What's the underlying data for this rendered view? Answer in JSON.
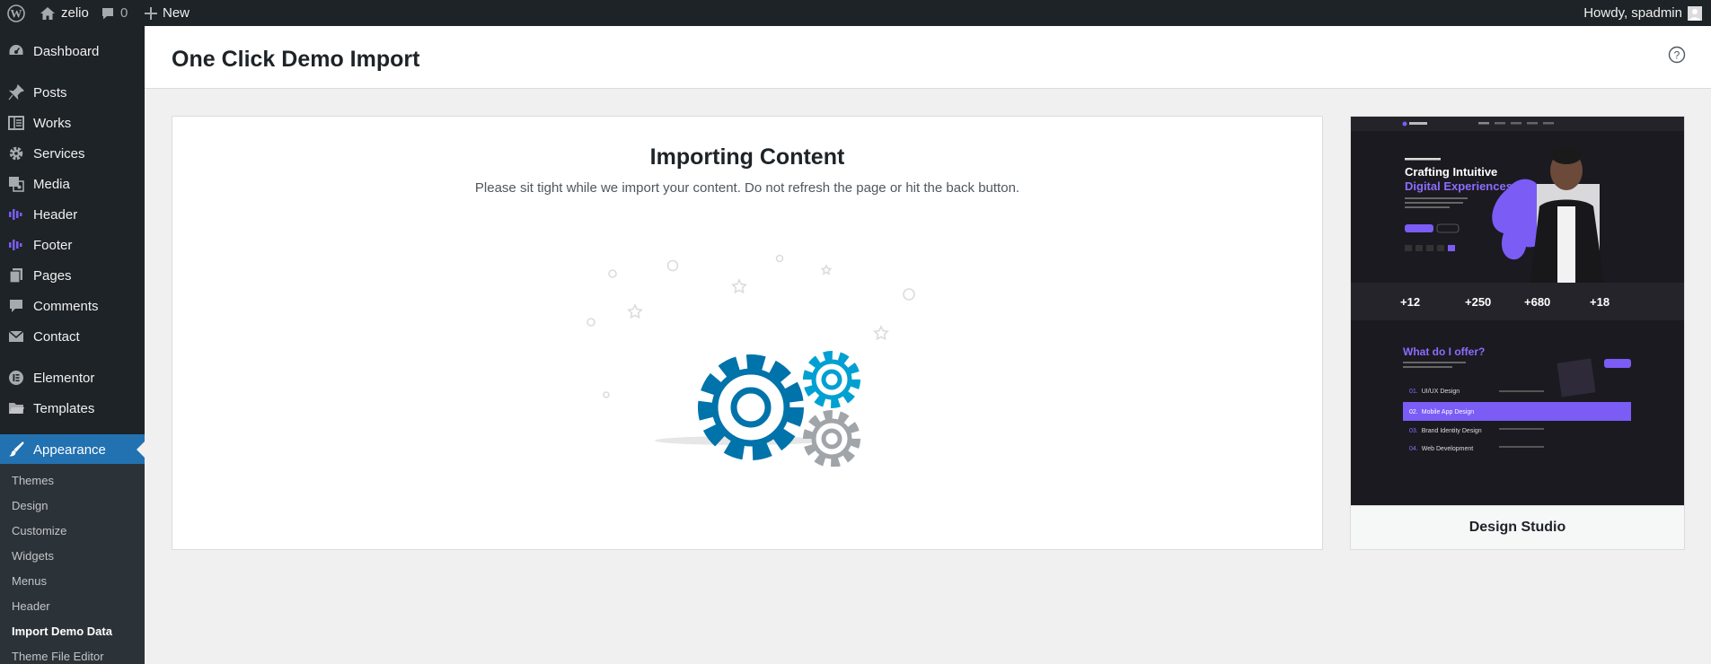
{
  "admin_bar": {
    "site_name": "zelio",
    "comments_count": "0",
    "new_label": "New",
    "greeting": "Howdy, spadmin"
  },
  "sidebar": {
    "items": [
      {
        "label": "Dashboard",
        "icon": "dashboard-icon"
      },
      {
        "label": "Posts",
        "icon": "pin-icon"
      },
      {
        "label": "Works",
        "icon": "portfolio-icon"
      },
      {
        "label": "Services",
        "icon": "gear-icon"
      },
      {
        "label": "Media",
        "icon": "media-icon"
      },
      {
        "label": "Header",
        "icon": "waveform-icon"
      },
      {
        "label": "Footer",
        "icon": "waveform-icon"
      },
      {
        "label": "Pages",
        "icon": "pages-icon"
      },
      {
        "label": "Comments",
        "icon": "comment-icon"
      },
      {
        "label": "Contact",
        "icon": "envelope-icon"
      },
      {
        "label": "Elementor",
        "icon": "elementor-icon"
      },
      {
        "label": "Templates",
        "icon": "folder-icon"
      },
      {
        "label": "Appearance",
        "icon": "paintbrush-icon"
      }
    ],
    "submenu": [
      "Themes",
      "Design",
      "Customize",
      "Widgets",
      "Menus",
      "Header",
      "Import Demo Data",
      "Theme File Editor"
    ]
  },
  "header": {
    "title": "One Click Demo Import"
  },
  "import": {
    "heading": "Importing Content",
    "message": "Please sit tight while we import your content. Do not refresh the page or hit the back button."
  },
  "preview": {
    "caption": "Design Studio",
    "hero_title_line1": "Crafting Intuitive",
    "hero_title_line2": "Digital Experiences",
    "stats": [
      "+12",
      "+250",
      "+680",
      "+18"
    ],
    "offer_title": "What do I offer?",
    "offer_items": [
      {
        "num": "01.",
        "label": "UI/UX Design"
      },
      {
        "num": "02.",
        "label": "Mobile App Design"
      },
      {
        "num": "03.",
        "label": "Brand Identity Design"
      },
      {
        "num": "04.",
        "label": "Web Development"
      }
    ]
  },
  "colors": {
    "admin_dark": "#1d2327",
    "submenu_bg": "#2c3338",
    "accent_blue": "#2271b1",
    "gear_dark_blue": "#0073aa",
    "gear_light_blue": "#00a0d2",
    "gear_gray": "#a0a5aa",
    "preview_purple": "#7b5cf5"
  }
}
